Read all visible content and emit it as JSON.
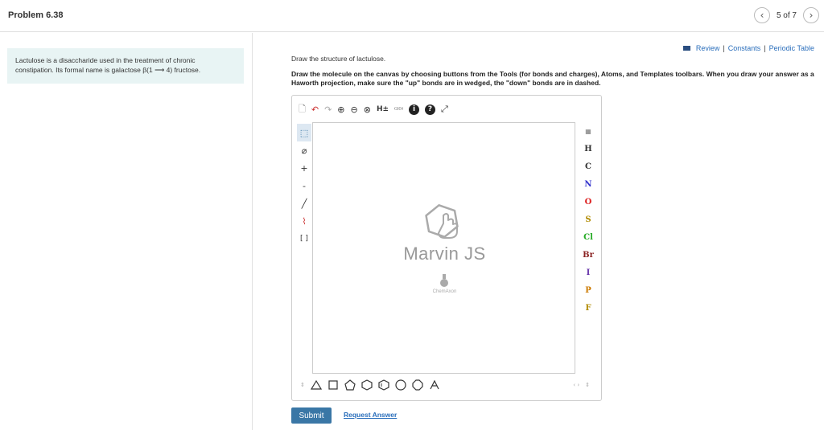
{
  "header": {
    "title": "Problem 6.38",
    "page_count": "5 of 7",
    "prev_icon": "‹",
    "next_icon": "›"
  },
  "left": {
    "info_line1": "Lactulose is a disaccharide used in the treatment of chronic",
    "info_line2": "constipation. Its formal name is galactose β(1 ⟶ 4) fructose."
  },
  "links": {
    "review": "Review",
    "sep1": "|",
    "constants": "Constants",
    "sep2": "|",
    "periodic": "Periodic Table"
  },
  "question": {
    "line1": "Draw the structure of lactulose.",
    "line2": "Draw the molecule on the canvas by choosing buttons from the Tools (for bonds and charges), Atoms, and Templates toolbars. When you draw your answer as a Haworth projection, make sure the \"up\" bonds are in wedged, the \"down\" bonds are in dashed."
  },
  "toolbar_top": {
    "new": "🗋",
    "undo": "↶",
    "redo": "↷",
    "zoom_in": "⊕",
    "zoom_out": "⊖",
    "clean": "⊗",
    "hydrogens": "H±",
    "layout_2d": "⁽²ᴰ⁾",
    "info": "i",
    "help": "?",
    "expand": "⤢"
  },
  "toolbar_left": {
    "select": "⬚",
    "erase": "⌀",
    "plus": "+",
    "minus": "-",
    "bond": "╱",
    "chain": "⌇",
    "bracket": "[ ]"
  },
  "atoms": [
    {
      "symbol": "H",
      "color": "#333333"
    },
    {
      "symbol": "C",
      "color": "#333333"
    },
    {
      "symbol": "N",
      "color": "#3333cc"
    },
    {
      "symbol": "O",
      "color": "#dd2222"
    },
    {
      "symbol": "S",
      "color": "#b08a00"
    },
    {
      "symbol": "Cl",
      "color": "#22aa22"
    },
    {
      "symbol": "Br",
      "color": "#8a2222"
    },
    {
      "symbol": "I",
      "color": "#6633aa"
    },
    {
      "symbol": "P",
      "color": "#cc7a00"
    },
    {
      "symbol": "F",
      "color": "#b08a00"
    }
  ],
  "logo": {
    "name": "Marvin JS",
    "sub": "ChemAxon"
  },
  "actions": {
    "submit": "Submit",
    "request": "Request Answer"
  }
}
